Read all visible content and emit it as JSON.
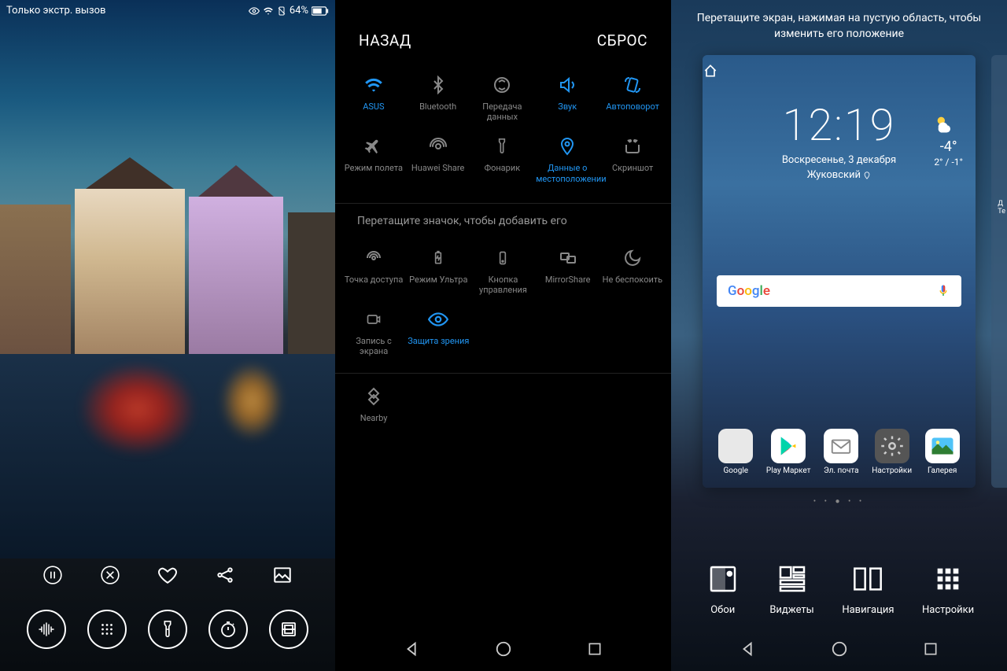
{
  "panel1": {
    "status_left": "Только экстр. вызов",
    "battery_pct": "64%"
  },
  "panel2": {
    "back": "НАЗАД",
    "reset": "СБРОС",
    "tiles_row1": [
      {
        "label": "ASUS",
        "icon": "wifi",
        "active": true
      },
      {
        "label": "Bluetooth",
        "icon": "bluetooth",
        "active": false
      },
      {
        "label": "Передача данных",
        "icon": "data",
        "active": false
      },
      {
        "label": "Звук",
        "icon": "sound",
        "active": true
      },
      {
        "label": "Автоповорот",
        "icon": "rotate",
        "active": true
      }
    ],
    "tiles_row2": [
      {
        "label": "Режим полета",
        "icon": "airplane",
        "active": false
      },
      {
        "label": "Huawei Share",
        "icon": "share",
        "active": false
      },
      {
        "label": "Фонарик",
        "icon": "flashlight",
        "active": false
      },
      {
        "label": "Данные о местоположении",
        "icon": "location",
        "active": true
      },
      {
        "label": "Скриншот",
        "icon": "screenshot",
        "active": false
      }
    ],
    "hint": "Перетащите значок, чтобы добавить его",
    "tiles_extra1": [
      {
        "label": "Точка доступа",
        "icon": "hotspot",
        "active": false
      },
      {
        "label": "Режим Ультра",
        "icon": "ultra",
        "active": false
      },
      {
        "label": "Кнопка управления",
        "icon": "navkey",
        "active": false
      },
      {
        "label": "MirrorShare",
        "icon": "mirror",
        "active": false
      },
      {
        "label": "Не беспокоить",
        "icon": "dnd",
        "active": false
      }
    ],
    "tiles_extra2": [
      {
        "label": "Запись с экрана",
        "icon": "record",
        "active": false
      },
      {
        "label": "Защита зрения",
        "icon": "eye",
        "active": true
      }
    ],
    "tiles_extra3": [
      {
        "label": "Nearby",
        "icon": "nearby",
        "active": false
      }
    ]
  },
  "panel3": {
    "hint": "Перетащите экран, нажимая на пустую область, чтобы изменить его положение",
    "time": "12:19",
    "date": "Воскресенье, 3 декабря",
    "city": "Жуковский",
    "temp": "-4°",
    "temp_range": "2° / -1°",
    "search_brand": "Google",
    "peek_label": "Д\nТе",
    "apps": [
      {
        "label": "Google"
      },
      {
        "label": "Play Маркет"
      },
      {
        "label": "Эл. почта"
      },
      {
        "label": "Настройки"
      },
      {
        "label": "Галерея"
      }
    ],
    "options": [
      {
        "label": "Обои"
      },
      {
        "label": "Виджеты"
      },
      {
        "label": "Навигация"
      },
      {
        "label": "Настройки"
      }
    ]
  }
}
